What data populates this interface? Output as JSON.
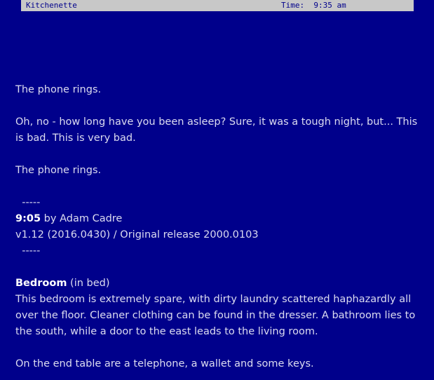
{
  "status_bar": {
    "location": "Kitchenette",
    "time_label": "Time:",
    "time_value": "9:35 am"
  },
  "story": {
    "line1": "The phone rings.",
    "line2": "Oh, no - how long have you been asleep? Sure, it was a tough night, but... This is bad. This is very bad.",
    "line3": "The phone rings.",
    "separator_top": "  -----",
    "game_title": "9:05",
    "byline": " by Adam Cadre",
    "version": "v1.12 (2016.0430) / Original release 2000.0103",
    "separator_bottom": "  -----",
    "room_name": "Bedroom",
    "room_state": " (in bed)",
    "room_description": "This bedroom is extremely spare, with dirty laundry scattered haphazardly all over the floor. Cleaner clothing can be found in the dresser. A bathroom lies to the south, while a door to the east leads to the living room.",
    "end_table": "On the end table are a telephone, a wallet and some keys."
  }
}
